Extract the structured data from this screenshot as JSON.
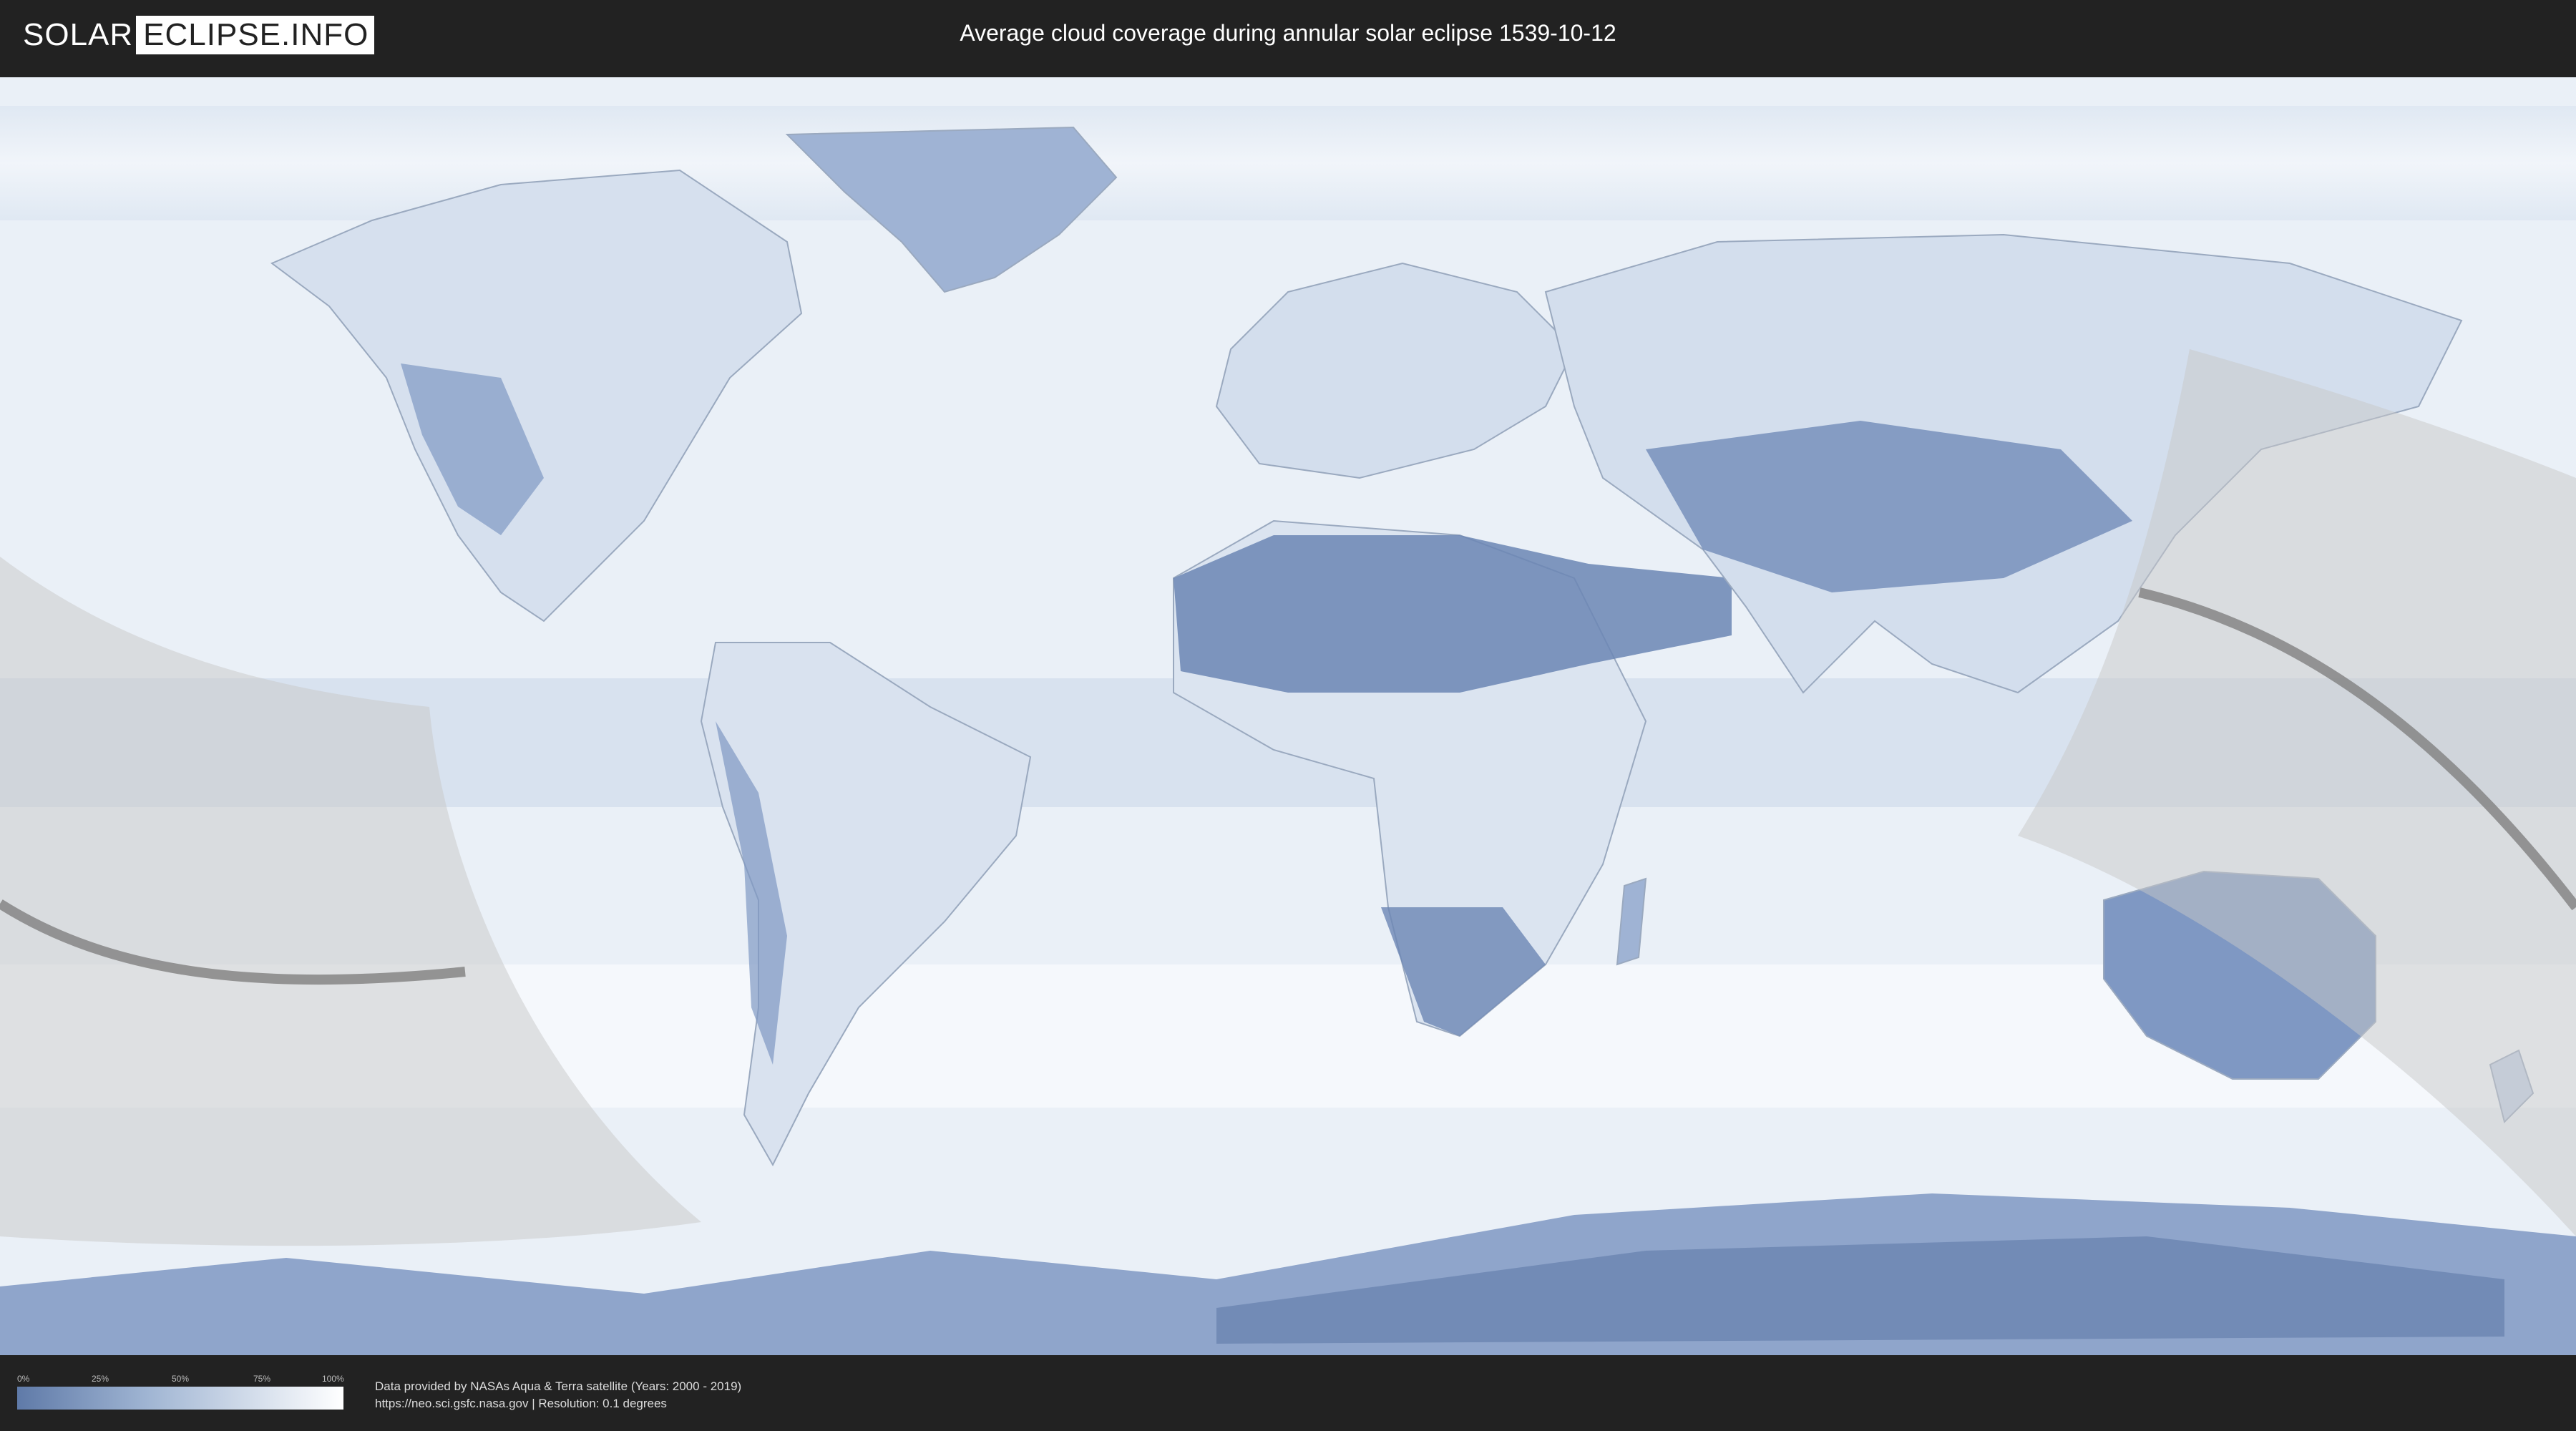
{
  "header": {
    "logo_part1": "SOLAR",
    "logo_part2": "ECLIPSE.INFO",
    "title": "Average cloud coverage during annular solar eclipse 1539-10-12"
  },
  "legend": {
    "ticks": [
      "0%",
      "25%",
      "50%",
      "75%",
      "100%"
    ],
    "gradient_colors": [
      "#5f7aa8",
      "#a0b5d3",
      "#ffffff"
    ]
  },
  "footer": {
    "credit_line1": "Data provided by NASAs Aqua & Terra satellite (Years: 2000 - 2019)",
    "credit_line2": "https://neo.sci.gsfc.nasa.gov | Resolution: 0.1 degrees"
  },
  "map": {
    "ocean_color": "#eef3f9",
    "land_dark_color": "#6b86b4",
    "land_light_color": "#dfe7f2",
    "shadow_color": "#c8c8c8",
    "path_color": "#808080"
  }
}
